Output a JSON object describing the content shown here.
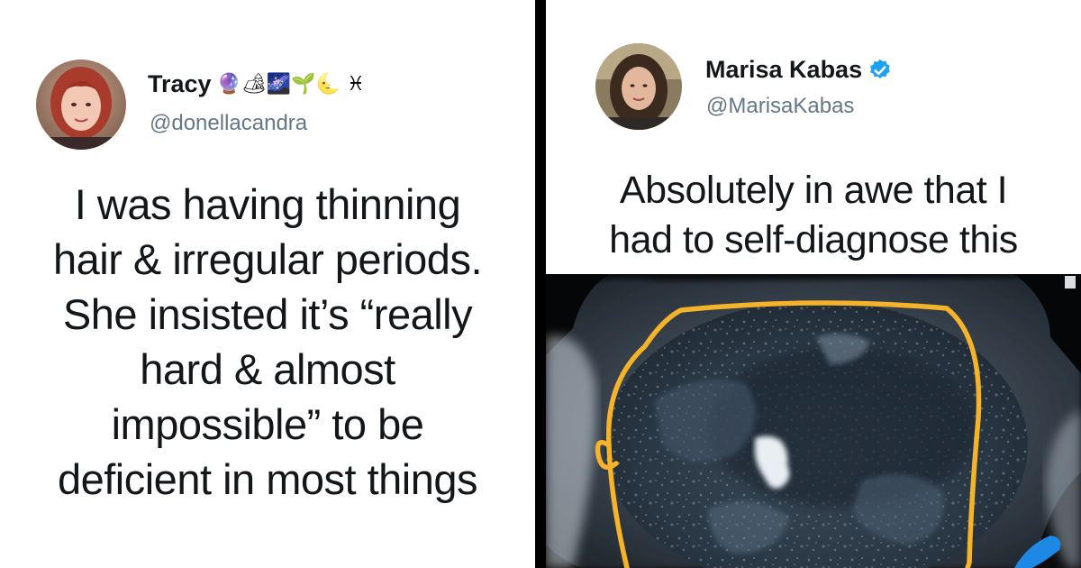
{
  "left_tweet": {
    "name": "Tracy",
    "name_emojis": "🔮🏕🌌🌱🌜 ♓",
    "handle": "@donellacandra",
    "text_lines": [
      "I was having thinning",
      "hair & irregular periods.",
      "She insisted it’s “really",
      "hard & almost",
      "impossible” to be",
      "deficient in most things"
    ]
  },
  "right_tweet": {
    "name": "Marisa Kabas",
    "handle": "@MarisaKabas",
    "verified": true,
    "text_lines": [
      "Absolutely in awe that I",
      "had to self-diagnose this"
    ]
  },
  "image": {
    "kind": "mri-scan",
    "annotation_color": "#f5b32a",
    "marker_color": "#1e88e5"
  },
  "colors": {
    "divider": "#000000",
    "name": "#14171a",
    "handle": "#657786",
    "verified": "#1da1f2"
  }
}
